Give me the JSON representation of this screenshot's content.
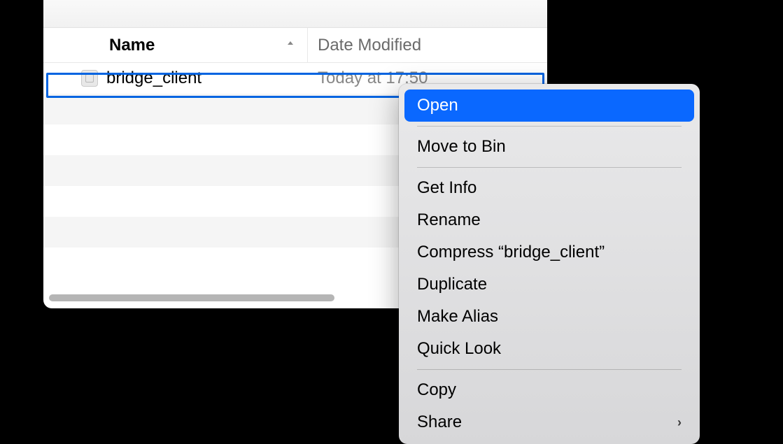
{
  "columns": {
    "name": "Name",
    "date": "Date Modified"
  },
  "file": {
    "name": "bridge_client",
    "date": "Today at 17:50"
  },
  "contextMenu": {
    "open": "Open",
    "moveToBin": "Move to Bin",
    "getInfo": "Get Info",
    "rename": "Rename",
    "compress": "Compress “bridge_client”",
    "duplicate": "Duplicate",
    "makeAlias": "Make Alias",
    "quickLook": "Quick Look",
    "copy": "Copy",
    "share": "Share"
  }
}
